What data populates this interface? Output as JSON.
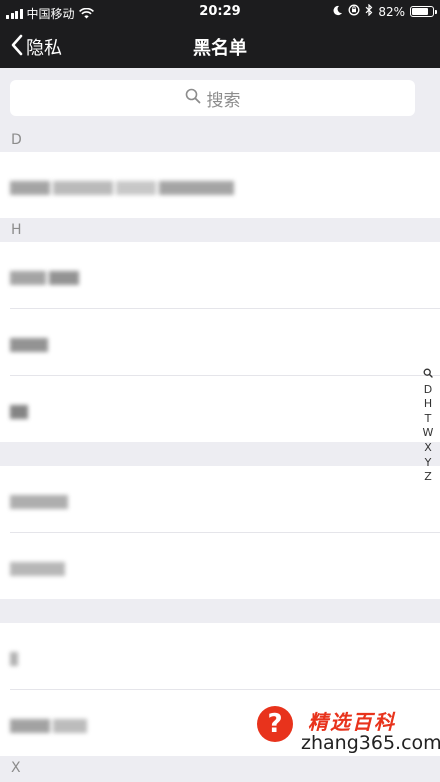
{
  "status_bar": {
    "carrier": "中国移动",
    "time": "20:29",
    "battery": "82%",
    "battery_level": 0.82,
    "icons": [
      "signal-icon",
      "wifi-icon",
      "moon-icon",
      "rotation-lock-icon",
      "bluetooth-icon",
      "battery-icon"
    ]
  },
  "nav": {
    "back_label": "隐私",
    "title": "黑名单"
  },
  "search": {
    "placeholder": "搜索"
  },
  "sections": [
    {
      "letter": "D",
      "rows": 1
    },
    {
      "letter": "H",
      "rows": 3
    },
    {
      "letter": "",
      "rows": 2
    },
    {
      "letter": "",
      "rows": 2
    },
    {
      "letter": "X",
      "rows": 0
    }
  ],
  "index_bar": [
    "D",
    "H",
    "T",
    "W",
    "X",
    "Y",
    "Z"
  ],
  "watermark": {
    "logo": "?",
    "title": "精选百科",
    "url": "zhang365.com"
  },
  "colors": {
    "bar_background": "#1c1c1e",
    "list_background": "#ededf2",
    "brand_red": "#e8331c"
  }
}
